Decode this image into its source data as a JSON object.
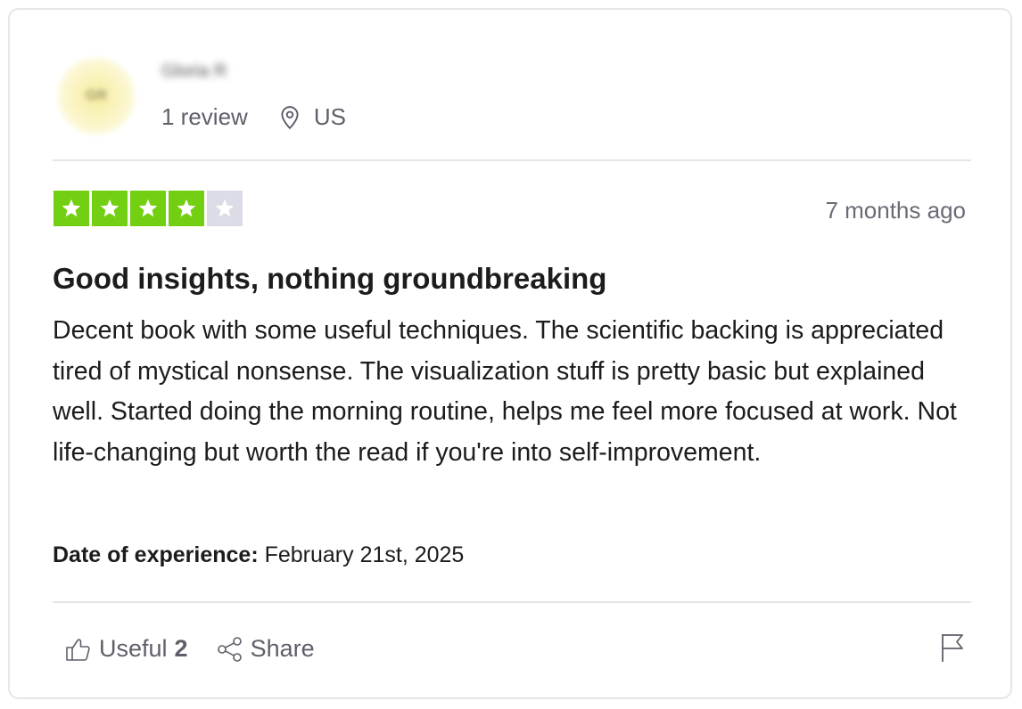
{
  "reviewer": {
    "initials": "GR",
    "name": "Gloria R",
    "review_count": "1 review",
    "location": "US"
  },
  "review": {
    "rating": 4,
    "rating_max": 5,
    "time_ago": "7 months ago",
    "title": "Good insights, nothing groundbreaking",
    "body": "Decent book with some useful techniques. The scientific backing is appreciated tired of mystical nonsense. The visualization stuff is pretty basic but explained well. Started doing the morning routine, helps me feel more focused at work. Not life-changing but worth the read if you're into self-improvement.",
    "date_label": "Date of experience:",
    "date_value": "February 21st, 2025"
  },
  "actions": {
    "useful_label": "Useful",
    "useful_count": "2",
    "share_label": "Share"
  },
  "colors": {
    "star_on": "#73cf11",
    "star_off": "#dcdce6",
    "text_muted": "#6b6b76"
  },
  "icons": [
    "location-pin-icon",
    "star-icon",
    "thumbs-up-icon",
    "share-icon",
    "flag-icon"
  ]
}
